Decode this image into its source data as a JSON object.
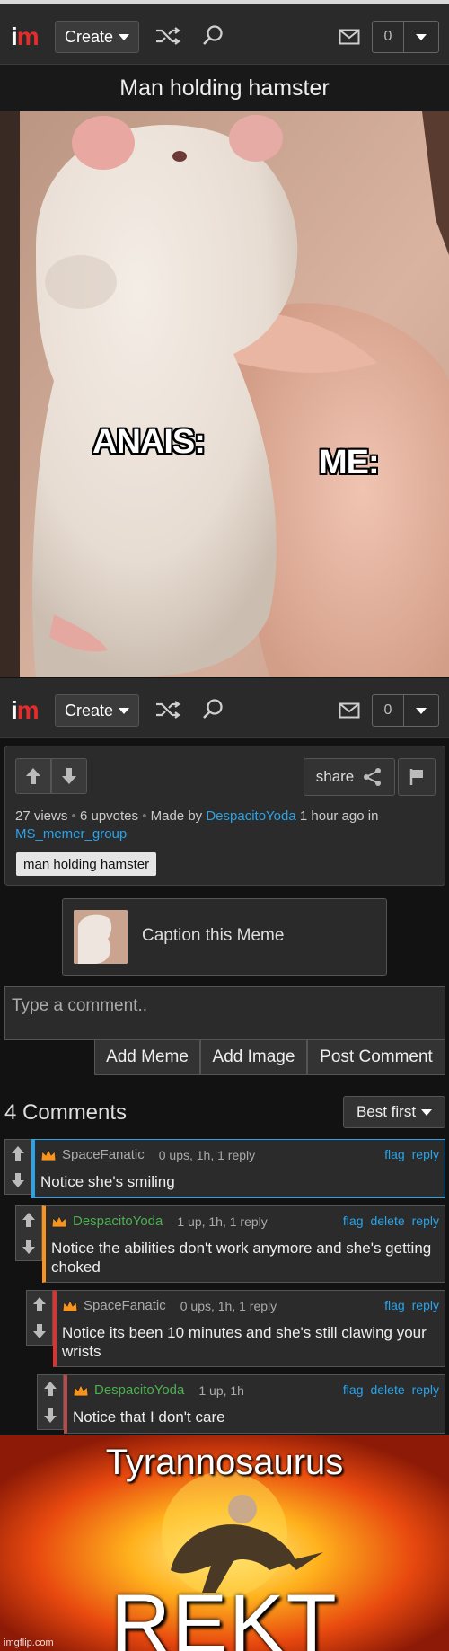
{
  "nav": {
    "logo_i": "i",
    "logo_m": "m",
    "create_label": "Create",
    "notification_count": "0"
  },
  "meme": {
    "title": "Man holding hamster",
    "caption_left": "ANAIS:",
    "caption_right": "ME:"
  },
  "post": {
    "share_label": "share",
    "views": "27 views",
    "upvotes": "6 upvotes",
    "made_by_prefix": "Made by",
    "author": "DespacitoYoda",
    "time_text": "1 hour ago in",
    "stream": "MS_memer_group",
    "tag": "man holding hamster"
  },
  "caption_button": {
    "label": "Caption this Meme"
  },
  "comment_form": {
    "placeholder": "Type a comment..",
    "add_meme": "Add Meme",
    "add_image": "Add Image",
    "post_comment": "Post Comment"
  },
  "comments_section": {
    "heading": "4 Comments",
    "sort_label": "Best first"
  },
  "comments": [
    {
      "user": "SpaceFanatic",
      "stats": "0 ups, 1h, 1 reply",
      "text": "Notice she's smiling",
      "actions": [
        "flag",
        "reply"
      ],
      "accent": "#2ba3e8"
    },
    {
      "user": "DespacitoYoda",
      "stats": "1 up, 1h, 1 reply",
      "text": "Notice the abilities don't work anymore and she's getting choked",
      "actions": [
        "flag",
        "delete",
        "reply"
      ],
      "accent": "#f7941d"
    },
    {
      "user": "SpaceFanatic",
      "stats": "0 ups, 1h, 1 reply",
      "text": "Notice its been 10 minutes and she's still clawing your wrists",
      "actions": [
        "flag",
        "reply"
      ],
      "accent": "#e03030"
    },
    {
      "user": "DespacitoYoda",
      "stats": "1 up, 1h",
      "text": "Notice that I don't care",
      "actions": [
        "flag",
        "delete",
        "reply"
      ],
      "accent": "#b84a4a"
    }
  ],
  "bottom_meme": {
    "top_text": "Tyrannosaurus",
    "bottom_text": "REKT",
    "watermark": "imgflip.com"
  },
  "colors": {
    "link": "#2ba3e8",
    "brand_red": "#e62b2b",
    "green_user": "#4caf50",
    "grey_user": "#aaaaaa"
  }
}
